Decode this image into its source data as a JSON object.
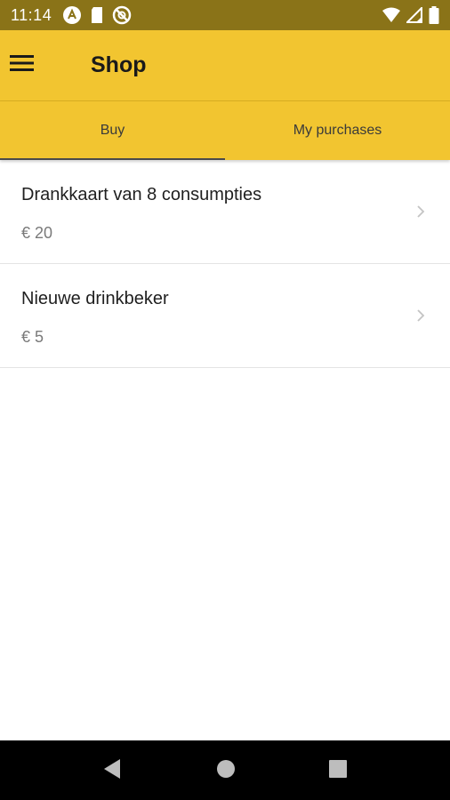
{
  "status_bar": {
    "time": "11:14",
    "left_icons": [
      "android-auto-icon",
      "sd-card-icon",
      "no-disturb-icon"
    ],
    "right_icons": [
      "wifi-icon",
      "signal-icon",
      "battery-icon"
    ]
  },
  "app_bar": {
    "menu_icon": "hamburger-menu-icon",
    "title": "Shop",
    "background": "#f2c530"
  },
  "tabs": [
    {
      "label": "Buy",
      "active": true
    },
    {
      "label": "My purchases",
      "active": false
    }
  ],
  "products": [
    {
      "title": "Drankkaart van 8 consumpties",
      "price": "€ 20"
    },
    {
      "title": "Nieuwe drinkbeker",
      "price": "€ 5"
    }
  ],
  "nav_bar": {
    "buttons": [
      "back-icon",
      "home-icon",
      "recents-icon"
    ]
  }
}
